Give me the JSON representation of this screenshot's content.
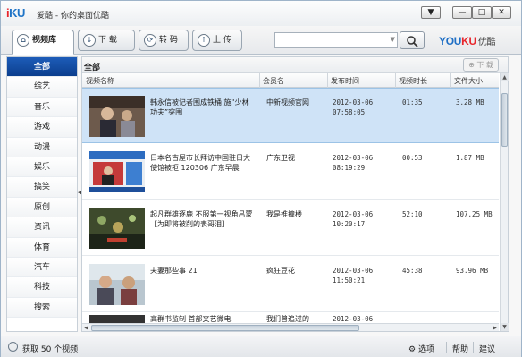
{
  "app": {
    "logo_i": "i",
    "logo_ku": "KU",
    "logo_cn": "爱酷",
    "title": "- 你的桌面优酷"
  },
  "window_controls": {
    "menu": "▼",
    "minimize": "—",
    "maximize": "□",
    "close": "✕"
  },
  "tabs": [
    {
      "label": "视频库",
      "icon": "home-icon",
      "active": true
    },
    {
      "label": "下 载",
      "icon": "download-icon",
      "active": false
    },
    {
      "label": "转 码",
      "icon": "convert-icon",
      "active": false
    },
    {
      "label": "上 传",
      "icon": "upload-icon",
      "active": false
    }
  ],
  "search": {
    "value": "",
    "placeholder": ""
  },
  "brand": {
    "you": "YOU",
    "ku": "KU",
    "sub": "优酷"
  },
  "sidebar": {
    "items": [
      {
        "label": "全部",
        "active": true
      },
      {
        "label": "综艺"
      },
      {
        "label": "音乐"
      },
      {
        "label": "游戏"
      },
      {
        "label": "动漫"
      },
      {
        "label": "娱乐"
      },
      {
        "label": "搞笑"
      },
      {
        "label": "原创"
      },
      {
        "label": "资讯"
      },
      {
        "label": "体育"
      },
      {
        "label": "汽车"
      },
      {
        "label": "科技"
      },
      {
        "label": "搜索"
      }
    ]
  },
  "main": {
    "breadcrumb": "全部",
    "download_button": "下 载",
    "columns": [
      "视频名称",
      "会员名",
      "发布时间",
      "视频时长",
      "文件大小"
    ],
    "rows": [
      {
        "title": "韩永信被记者围成铁桶 施“少林功夫”突围",
        "member": "中新视频官网",
        "date": "2012-03-06",
        "time": "07:58:05",
        "duration": "01:35",
        "size": "3.28 MB"
      },
      {
        "title": "日本名古屋市长拜访中国驻日大使馆被拒 120306 广东早晨",
        "member": "广东卫视",
        "date": "2012-03-06",
        "time": "08:19:29",
        "duration": "00:53",
        "size": "1.87 MB"
      },
      {
        "title": "起凡群雄逐鹿 不服第一视角吕蒙【为即将被削的表哥泪】",
        "member": "我是推撞楼",
        "date": "2012-03-06",
        "time": "10:20:17",
        "duration": "52:10",
        "size": "107.25 MB"
      },
      {
        "title": "夫妻那些事 21",
        "member": "疯狂豆花",
        "date": "2012-03-06",
        "time": "11:50:21",
        "duration": "45:38",
        "size": "93.96 MB"
      },
      {
        "title": "高群书监制 首部文艺微电",
        "member": "我们曾追过的",
        "date": "2012-03-06",
        "time": "",
        "duration": "",
        "size": ""
      }
    ]
  },
  "status": {
    "text": "获取 50 个视频",
    "options": "选项",
    "help": "帮助",
    "suggest": "建议"
  },
  "colors": {
    "accent": "#1d5cb8",
    "selected_row": "#cfe3f7",
    "iku_red": "#e8262c",
    "iku_blue": "#1f74c7"
  }
}
